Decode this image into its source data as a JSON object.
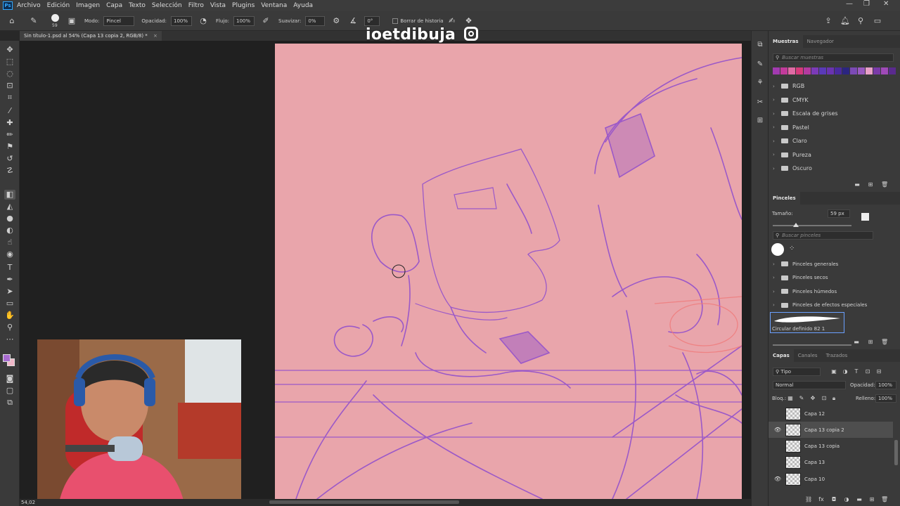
{
  "menu": {
    "items": [
      "Archivo",
      "Edición",
      "Imagen",
      "Capa",
      "Texto",
      "Selección",
      "Filtro",
      "Vista",
      "Plugins",
      "Ventana",
      "Ayuda"
    ]
  },
  "options": {
    "brush_size": "59",
    "mode_label": "Modo:",
    "mode_value": "Pincel",
    "opacity_label": "Opacidad:",
    "opacity_value": "100%",
    "flow_label": "Flujo:",
    "flow_value": "100%",
    "smooth_label": "Suavizar:",
    "smooth_value": "0%",
    "angle_value": "0°",
    "history_label": "Borrar de historia"
  },
  "document": {
    "tab_title": "Sin título-1.psd al 54% (Capa 13 copia 2, RGB/8) *",
    "close_glyph": "×",
    "zoom_status": "54,02"
  },
  "watermark": "ioetdibuja",
  "swatches": {
    "tab_active": "Muestras",
    "tab_other": "Navegador",
    "search_placeholder": "Buscar muestras",
    "colors": [
      "#a23ab0",
      "#c23b9b",
      "#e06aa4",
      "#d63a7b",
      "#b43aa0",
      "#7c3ab8",
      "#5a3ab8",
      "#6a33b0",
      "#4a2a9e",
      "#2b2580",
      "#7c4ab6",
      "#9a5ac0",
      "#e8a0c8",
      "#7a3aa8",
      "#a04ab8",
      "#5a2a8e"
    ],
    "folders": [
      "RGB",
      "CMYK",
      "Escala de grises",
      "Pastel",
      "Claro",
      "Pureza",
      "Oscuro"
    ]
  },
  "brushes": {
    "title": "Pinceles",
    "size_label": "Tamaño:",
    "size_value": "59 px",
    "search_placeholder": "Buscar pinceles",
    "folders": [
      "Pinceles generales",
      "Pinceles secos",
      "Pinceles húmedos",
      "Pinceles de efectos especiales"
    ],
    "preset_name": "Circular definido 82 1"
  },
  "layers": {
    "tab_active": "Capas",
    "tab_channels": "Canales",
    "tab_paths": "Trazados",
    "filter_kind": "Tipo",
    "blend_mode": "Normal",
    "opacity_label": "Opacidad:",
    "opacity_value": "100%",
    "lock_label": "Bloq.:",
    "fill_label": "Relleno:",
    "fill_value": "100%",
    "items": [
      {
        "name": "Capa 12",
        "visible": false,
        "selected": false
      },
      {
        "name": "Capa 13 copia 2",
        "visible": true,
        "selected": true
      },
      {
        "name": "Capa 13 copia",
        "visible": false,
        "selected": false
      },
      {
        "name": "Capa 13",
        "visible": false,
        "selected": false
      },
      {
        "name": "Capa 10",
        "visible": true,
        "selected": false
      }
    ]
  },
  "colors": {
    "canvas_bg": "#e9a5ab",
    "sketch": "#9b59c8",
    "sketch_red": "#f07a7a",
    "foreground": "#a86bd0",
    "background": "#f0b8c8"
  }
}
